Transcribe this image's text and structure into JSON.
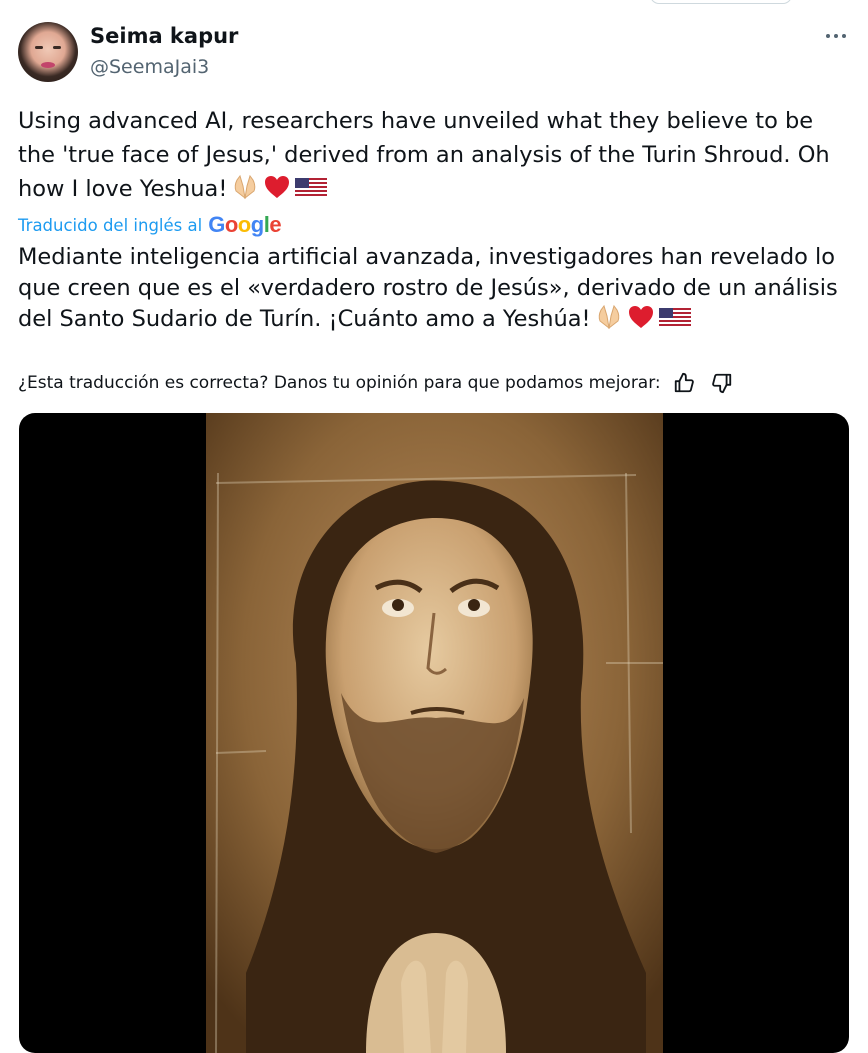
{
  "author": {
    "name": "Seima kapur",
    "handle": "@SeemaJai3"
  },
  "icons": {
    "more": "more-horizontal-icon",
    "thumbs_up": "thumbs-up-icon",
    "thumbs_down": "thumbs-down-icon",
    "emojis": [
      "folded-hands-emoji",
      "red-heart-emoji",
      "us-flag-emoji"
    ]
  },
  "tweet": {
    "text": "Using advanced AI, researchers have unveiled what they believe to be the 'true face of Jesus,' derived from an analysis of the Turin Shroud. Oh how I love Yeshua!"
  },
  "translation": {
    "label": "Traducido del inglés al",
    "provider_parts": [
      "G",
      "o",
      "o",
      "g",
      "l",
      "e"
    ],
    "text": "Mediante inteligencia artificial avanzada, investigadores han revelado lo que creen que es el «verdadero rostro de Jesús», derivado de un análisis del Santo Sudario de Turín. ¡Cuánto amo a Yeshúa!",
    "feedback_prompt": "¿Esta traducción es correcta? Danos tu opinión para que podamos mejorar:"
  },
  "colors": {
    "link_blue": "#1d9bf0",
    "secondary_text": "#536471",
    "google_blue": "#4285f4",
    "google_red": "#ea4335",
    "google_yellow": "#fbbc05",
    "google_green": "#34a853"
  }
}
